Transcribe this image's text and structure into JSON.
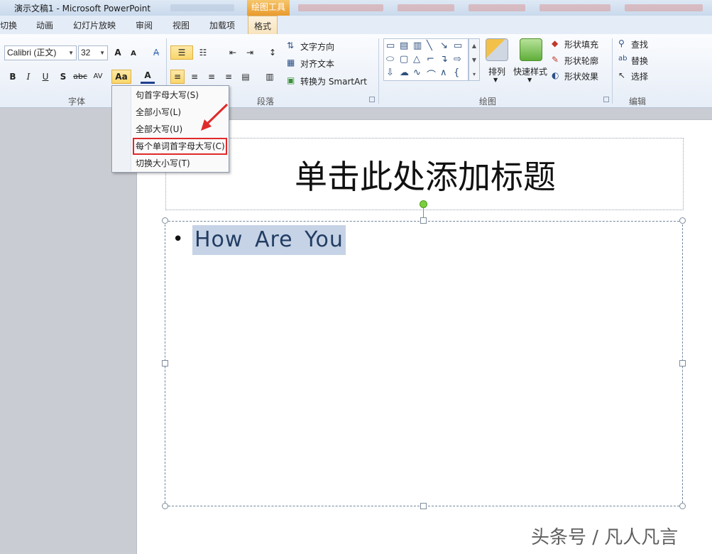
{
  "window": {
    "title": "演示文稿1 - Microsoft PowerPoint",
    "context_group": "绘图工具"
  },
  "tabs": [
    {
      "label": "切换"
    },
    {
      "label": "动画"
    },
    {
      "label": "幻灯片放映"
    },
    {
      "label": "审阅"
    },
    {
      "label": "视图"
    },
    {
      "label": "加载项"
    },
    {
      "label": "格式"
    }
  ],
  "font_group": {
    "font_name": "Calibri (正文)",
    "font_size": "32",
    "grow_label": "A",
    "shrink_label": "A",
    "bold": "B",
    "italic": "I",
    "underline": "U",
    "shadow": "S",
    "strike": "abc",
    "spacing": "AV",
    "change_case": "Aa",
    "font_color": "A",
    "label": "字体"
  },
  "paragraph_group": {
    "text_direction": "文字方向",
    "align_text": "对齐文本",
    "smartart": "转换为 SmartArt",
    "label": "段落"
  },
  "drawing_group": {
    "arrange": "排列",
    "quick_styles": "快速样式",
    "shape_fill": "形状填充",
    "shape_outline": "形状轮廓",
    "shape_effects": "形状效果",
    "label": "绘图"
  },
  "editing_group": {
    "find": "查找",
    "replace": "替换",
    "select": "选择",
    "label": "编辑"
  },
  "case_menu": {
    "items": [
      "句首字母大写(S)",
      "全部小写(L)",
      "全部大写(U)",
      "每个单词首字母大写(C)",
      "切换大小写(T)"
    ],
    "highlight_color": "#e02a2a"
  },
  "slide": {
    "title_placeholder": "单击此处添加标题",
    "bullet": "•",
    "body_text": "How Are You"
  },
  "watermark": "头条号 / 凡人凡言",
  "colors": {
    "accent": "#f9d66a",
    "context_tab": "#e89a2d",
    "selection": "#c6d3e6"
  }
}
